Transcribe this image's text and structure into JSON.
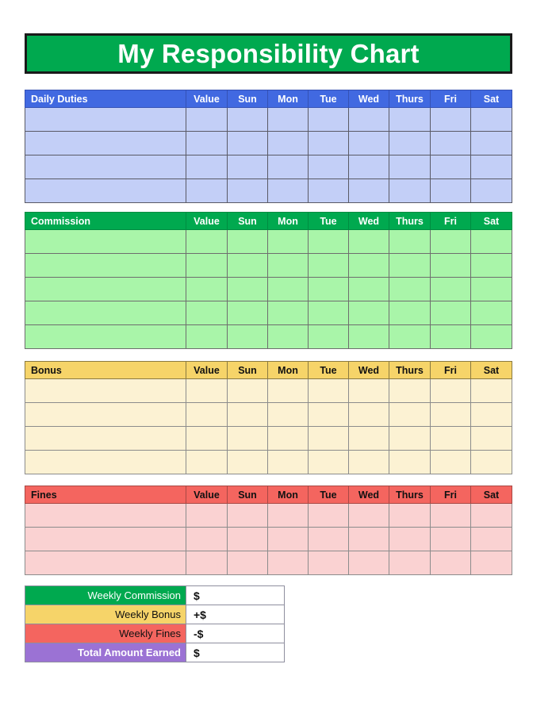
{
  "title": {
    "text": "My Responsibility Chart",
    "background": "#00A94F",
    "text_color": "#ffffff"
  },
  "columns": {
    "value": "Value",
    "days": [
      "Sun",
      "Mon",
      "Tue",
      "Wed",
      "Thurs",
      "Fri",
      "Sat"
    ]
  },
  "sections": [
    {
      "key": "daily_duties",
      "label": "Daily Duties",
      "header_bg": "#4169E1",
      "header_fg": "#ffffff",
      "body_bg": "#C3CFF7",
      "rows": 4,
      "entries": [
        {
          "name": "",
          "value": "",
          "Sun": "",
          "Mon": "",
          "Tue": "",
          "Wed": "",
          "Thurs": "",
          "Fri": "",
          "Sat": ""
        },
        {
          "name": "",
          "value": "",
          "Sun": "",
          "Mon": "",
          "Tue": "",
          "Wed": "",
          "Thurs": "",
          "Fri": "",
          "Sat": ""
        },
        {
          "name": "",
          "value": "",
          "Sun": "",
          "Mon": "",
          "Tue": "",
          "Wed": "",
          "Thurs": "",
          "Fri": "",
          "Sat": ""
        },
        {
          "name": "",
          "value": "",
          "Sun": "",
          "Mon": "",
          "Tue": "",
          "Wed": "",
          "Thurs": "",
          "Fri": "",
          "Sat": ""
        }
      ]
    },
    {
      "key": "commission",
      "label": "Commission",
      "header_bg": "#00A94F",
      "header_fg": "#ffffff",
      "body_bg": "#A9F5A9",
      "rows": 5,
      "entries": [
        {
          "name": "",
          "value": "",
          "Sun": "",
          "Mon": "",
          "Tue": "",
          "Wed": "",
          "Thurs": "",
          "Fri": "",
          "Sat": ""
        },
        {
          "name": "",
          "value": "",
          "Sun": "",
          "Mon": "",
          "Tue": "",
          "Wed": "",
          "Thurs": "",
          "Fri": "",
          "Sat": ""
        },
        {
          "name": "",
          "value": "",
          "Sun": "",
          "Mon": "",
          "Tue": "",
          "Wed": "",
          "Thurs": "",
          "Fri": "",
          "Sat": ""
        },
        {
          "name": "",
          "value": "",
          "Sun": "",
          "Mon": "",
          "Tue": "",
          "Wed": "",
          "Thurs": "",
          "Fri": "",
          "Sat": ""
        },
        {
          "name": "",
          "value": "",
          "Sun": "",
          "Mon": "",
          "Tue": "",
          "Wed": "",
          "Thurs": "",
          "Fri": "",
          "Sat": ""
        }
      ]
    },
    {
      "key": "bonus",
      "label": "Bonus",
      "header_bg": "#F6D469",
      "header_fg": "#111111",
      "body_bg": "#FCF2D3",
      "rows": 4,
      "entries": [
        {
          "name": "",
          "value": "",
          "Sun": "",
          "Mon": "",
          "Tue": "",
          "Wed": "",
          "Thurs": "",
          "Fri": "",
          "Sat": ""
        },
        {
          "name": "",
          "value": "",
          "Sun": "",
          "Mon": "",
          "Tue": "",
          "Wed": "",
          "Thurs": "",
          "Fri": "",
          "Sat": ""
        },
        {
          "name": "",
          "value": "",
          "Sun": "",
          "Mon": "",
          "Tue": "",
          "Wed": "",
          "Thurs": "",
          "Fri": "",
          "Sat": ""
        },
        {
          "name": "",
          "value": "",
          "Sun": "",
          "Mon": "",
          "Tue": "",
          "Wed": "",
          "Thurs": "",
          "Fri": "",
          "Sat": ""
        }
      ]
    },
    {
      "key": "fines",
      "label": "Fines",
      "header_bg": "#F4655F",
      "header_fg": "#111111",
      "body_bg": "#FAD2D2",
      "rows": 3,
      "entries": [
        {
          "name": "",
          "value": "",
          "Sun": "",
          "Mon": "",
          "Tue": "",
          "Wed": "",
          "Thurs": "",
          "Fri": "",
          "Sat": ""
        },
        {
          "name": "",
          "value": "",
          "Sun": "",
          "Mon": "",
          "Tue": "",
          "Wed": "",
          "Thurs": "",
          "Fri": "",
          "Sat": ""
        },
        {
          "name": "",
          "value": "",
          "Sun": "",
          "Mon": "",
          "Tue": "",
          "Wed": "",
          "Thurs": "",
          "Fri": "",
          "Sat": ""
        }
      ]
    }
  ],
  "summary": {
    "rows": [
      {
        "key": "weekly_commission",
        "label": "Weekly Commission",
        "value": "$",
        "label_bg": "#00A94F",
        "label_fg": "#ffffff"
      },
      {
        "key": "weekly_bonus",
        "label": "Weekly Bonus",
        "value": "+$",
        "label_bg": "#F6D469",
        "label_fg": "#111111"
      },
      {
        "key": "weekly_fines",
        "label": "Weekly Fines",
        "value": "-$",
        "label_bg": "#F4655F",
        "label_fg": "#111111"
      },
      {
        "key": "total_earned",
        "label": "Total Amount Earned",
        "value": "$",
        "label_bg": "#9B72D4",
        "label_fg": "#ffffff"
      }
    ]
  }
}
